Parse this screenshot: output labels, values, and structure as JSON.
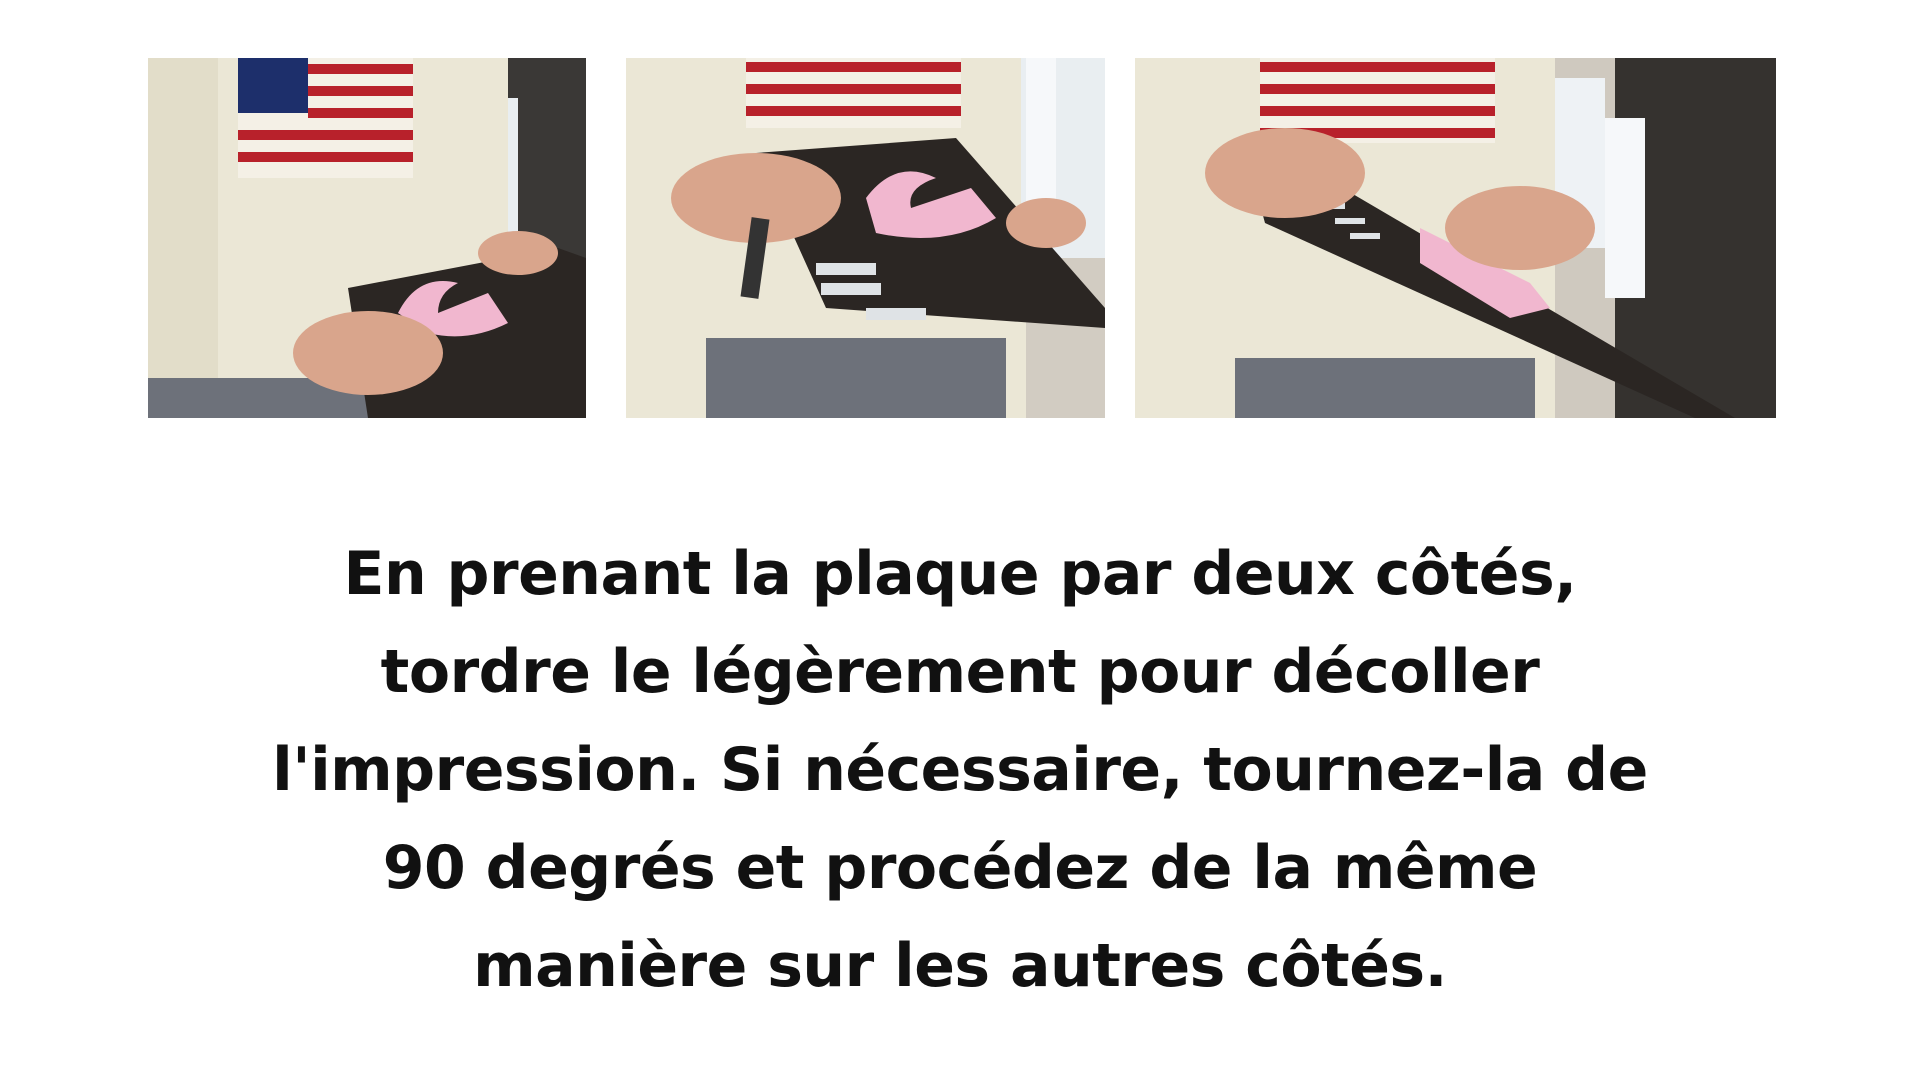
{
  "photos": [
    {
      "icon": "photo-holding-print-plate"
    },
    {
      "icon": "photo-bending-print-plate"
    },
    {
      "icon": "photo-peeling-print"
    }
  ],
  "caption": {
    "lines": [
      "En prenant la plaque par deux côtés,",
      "tordre le légèrement pour décoller",
      "l'impression. Si nécessaire, tournez-la de",
      "90 degrés et procédez de la même",
      "manière sur les autres côtés."
    ]
  },
  "colors": {
    "background": "#ffffff",
    "text": "#111111",
    "sweater": "#ece8d8",
    "flag_red": "#b8212b",
    "flag_blue": "#1d2f6b",
    "plate": "#2b2623",
    "print_pink": "#f1b7cf",
    "skin": "#d9a58c"
  }
}
